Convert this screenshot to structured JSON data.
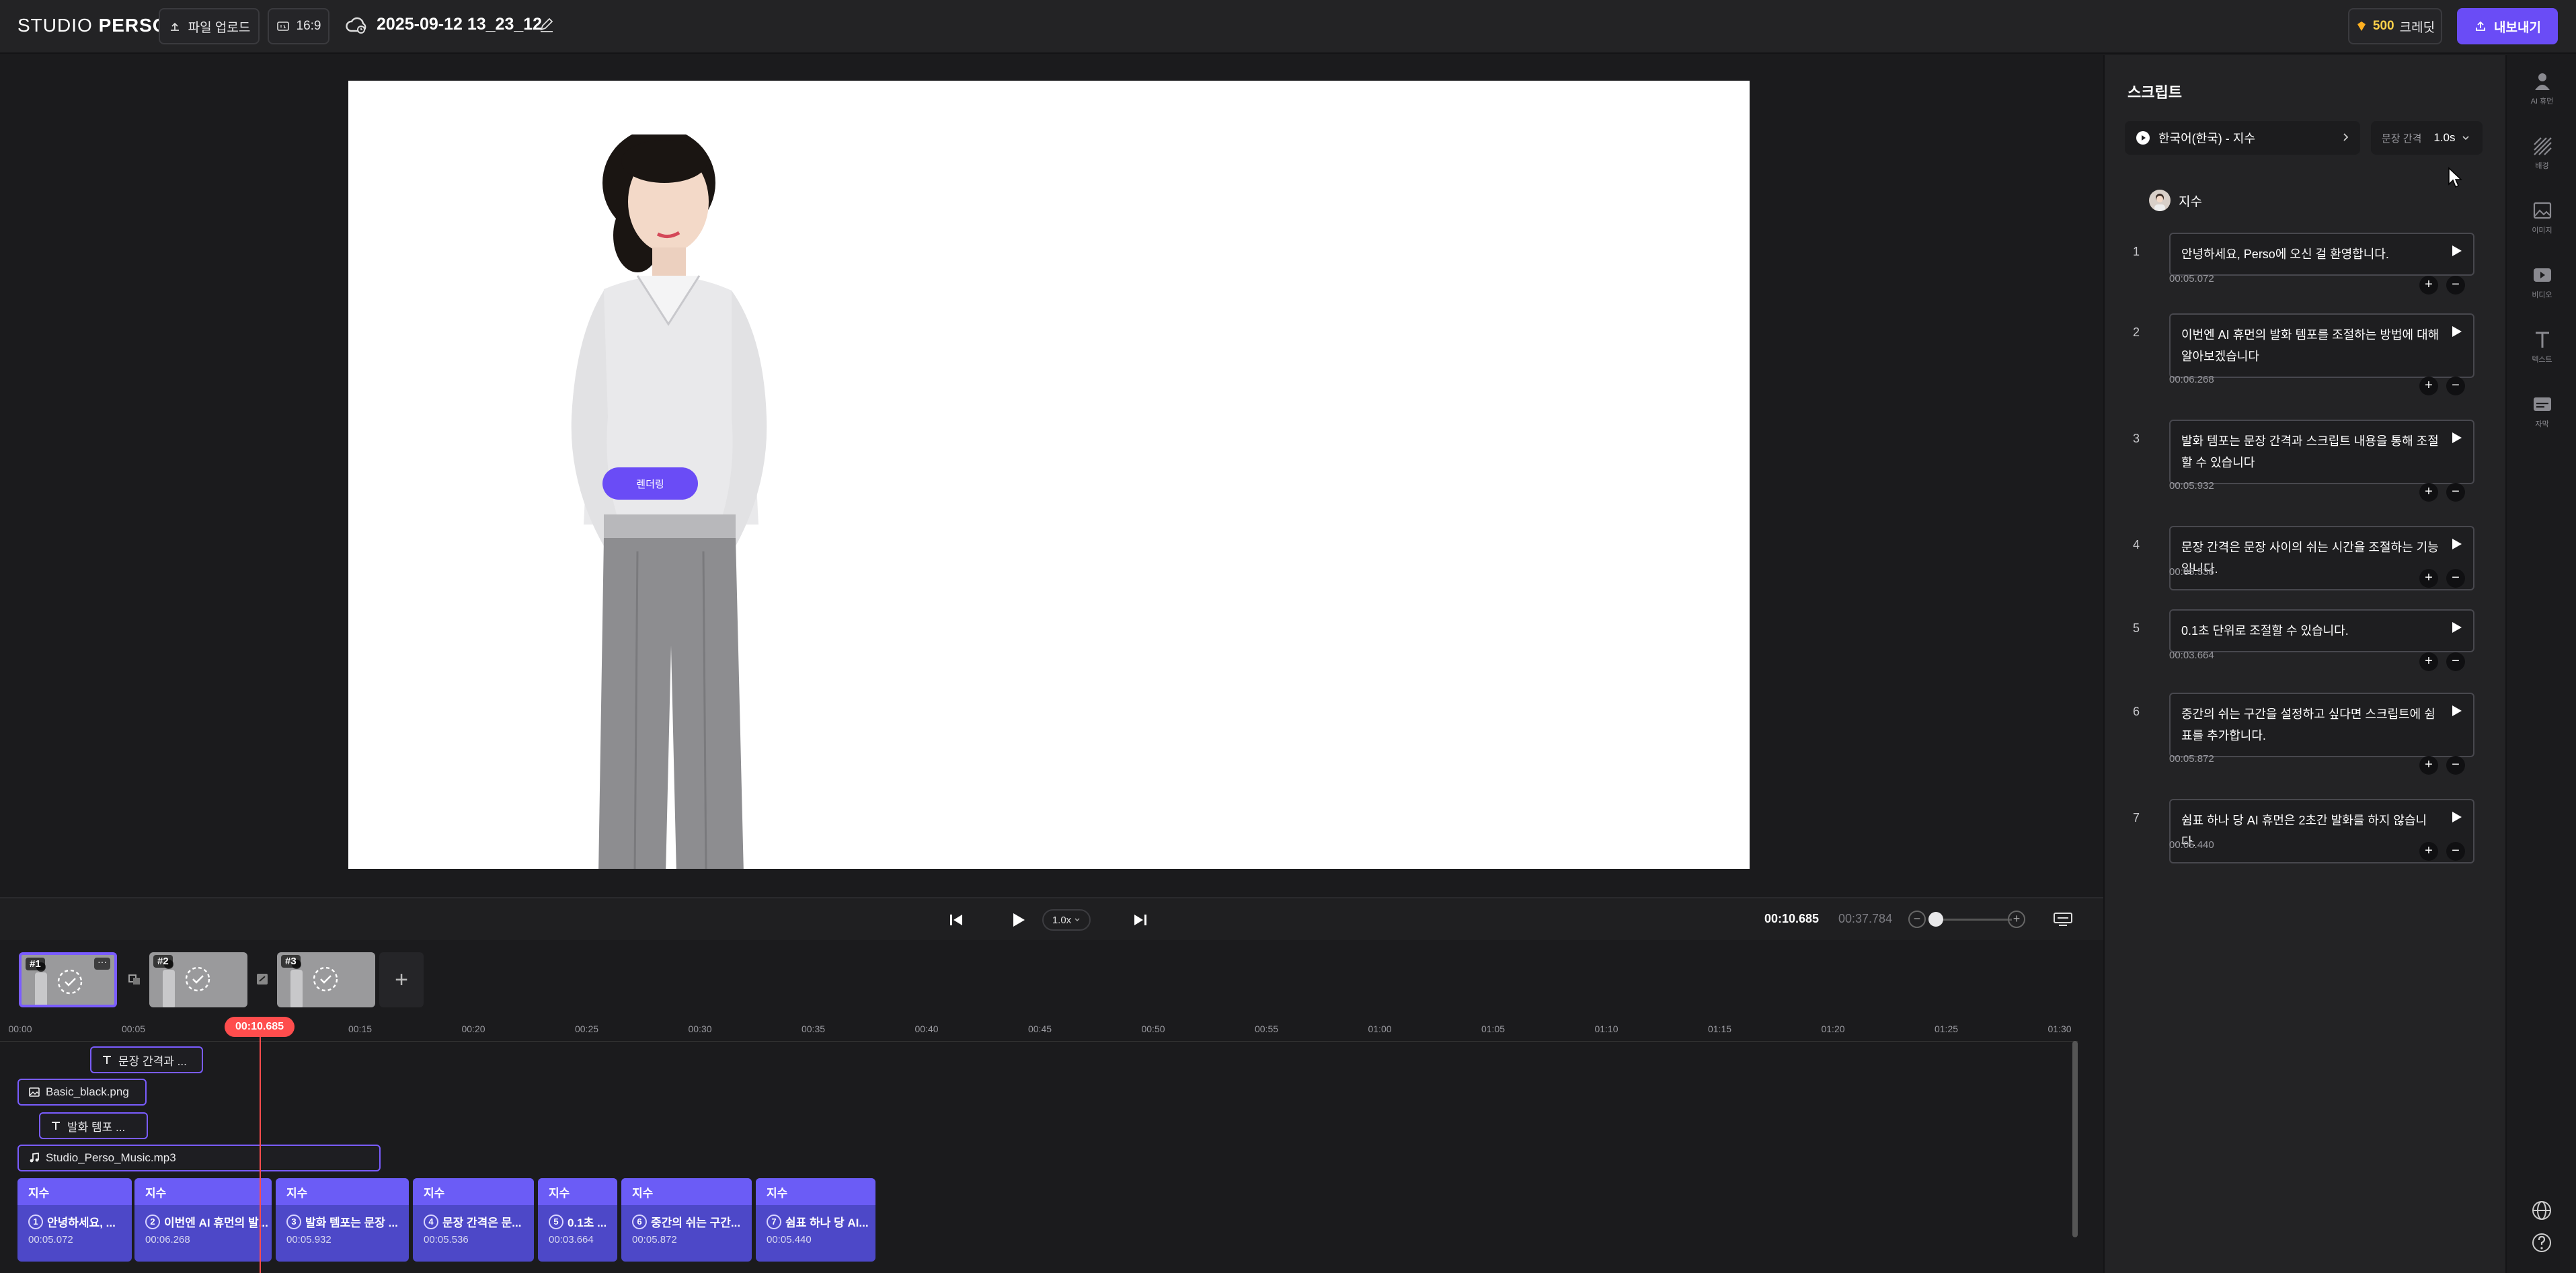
{
  "header": {
    "logo_light": "STUDIO",
    "logo_bold": "PERSO",
    "upload_label": "파일 업로드",
    "ratio_label": "16:9",
    "project_title": "2025-09-12 13_23_12",
    "credit_amount": "500",
    "credit_label": "크레딧",
    "export_label": "내보내기"
  },
  "canvas": {
    "render_badge": "렌더링"
  },
  "player": {
    "speed": "1.0x",
    "current_time": "00:10.685",
    "total_time": "00:37.784"
  },
  "scenes": [
    {
      "tag": "#1",
      "active": true
    },
    {
      "tag": "#2",
      "active": false
    },
    {
      "tag": "#3",
      "active": false
    }
  ],
  "timeline": {
    "ruler": [
      "00:00",
      "00:05",
      "00:10",
      "00:15",
      "00:20",
      "00:25",
      "00:30",
      "00:35",
      "00:40",
      "00:45",
      "00:50",
      "00:55",
      "01:00",
      "01:05",
      "01:10",
      "01:15",
      "01:20",
      "01:25",
      "01:30"
    ],
    "playhead": "00:10.685",
    "text_clip_1": "문장 간격과 ...",
    "image_clip": "Basic_black.png",
    "text_clip_2": "발화 템포 ...",
    "audio_clip": "Studio_Perso_Music.mp3",
    "segments": [
      {
        "speaker": "지수",
        "num": "1",
        "text": "안녕하세요, ...",
        "time": "00:05.072"
      },
      {
        "speaker": "지수",
        "num": "2",
        "text": "이번엔 AI 휴먼의 발...",
        "time": "00:06.268"
      },
      {
        "speaker": "지수",
        "num": "3",
        "text": "발화 템포는 문장 ...",
        "time": "00:05.932"
      },
      {
        "speaker": "지수",
        "num": "4",
        "text": "문장 간격은 문...",
        "time": "00:05.536"
      },
      {
        "speaker": "지수",
        "num": "5",
        "text": "0.1초 ...",
        "time": "00:03.664"
      },
      {
        "speaker": "지수",
        "num": "6",
        "text": "중간의 쉬는 구간...",
        "time": "00:05.872"
      },
      {
        "speaker": "지수",
        "num": "7",
        "text": "쉼표 하나 당 AI...",
        "time": "00:05.440"
      }
    ]
  },
  "script": {
    "title": "스크립트",
    "voice": "한국어(한국) - 지수",
    "interval_label": "문장 간격",
    "interval_value": "1.0s",
    "speaker": "지수",
    "lines": [
      {
        "num": "1",
        "text": "안녕하세요, Perso에 오신 걸 환영합니다.",
        "dur": "00:05.072"
      },
      {
        "num": "2",
        "text": "이번엔 AI 휴먼의 발화 템포를 조절하는 방법에 대해 알아보겠습니다",
        "dur": "00:06.268"
      },
      {
        "num": "3",
        "text": "발화 템포는 문장 간격과 스크립트 내용을 통해 조절할 수 있습니다",
        "dur": "00:05.932"
      },
      {
        "num": "4",
        "text": "문장 간격은 문장 사이의 쉬는 시간을 조절하는 기능입니다.",
        "dur": "00:05.536"
      },
      {
        "num": "5",
        "text": "0.1초 단위로 조절할 수 있습니다.",
        "dur": "00:03.664"
      },
      {
        "num": "6",
        "text": "중간의 쉬는 구간을 설정하고 싶다면 스크립트에 쉼표를 추가합니다.",
        "dur": "00:05.872"
      },
      {
        "num": "7",
        "text": "쉼표 하나 당 AI 휴먼은 2초간 발화를 하지 않습니다.",
        "dur": "00:05.440"
      }
    ]
  },
  "rail": {
    "tools": [
      "AI 휴먼",
      "배경",
      "이미지",
      "비디오",
      "텍스트",
      "자막"
    ]
  },
  "colors": {
    "accent": "#6a4cf6",
    "playhead": "#ff4d4d",
    "credit": "#ffd24a"
  }
}
